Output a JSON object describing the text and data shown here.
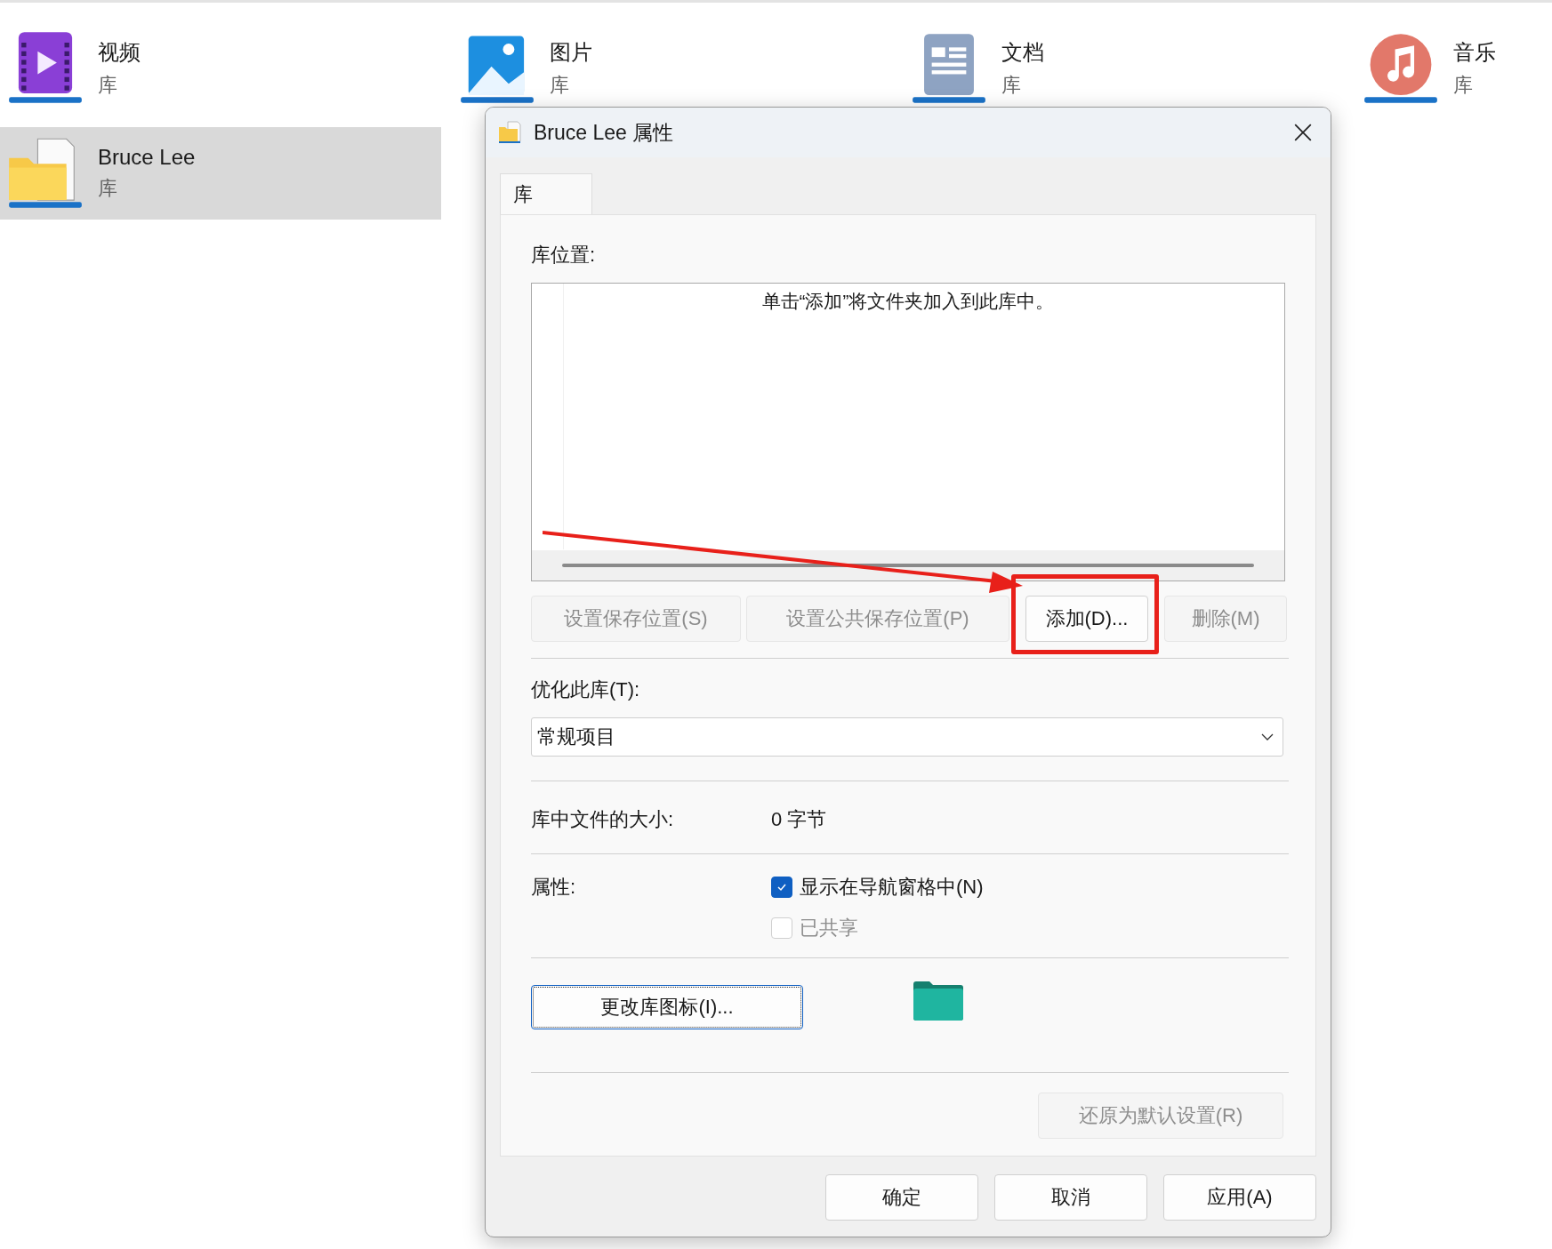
{
  "library_tiles": [
    {
      "name": "视频",
      "type": "库",
      "kind": "video",
      "selected": false
    },
    {
      "name": "图片",
      "type": "库",
      "kind": "picture",
      "selected": false
    },
    {
      "name": "文档",
      "type": "库",
      "kind": "document",
      "selected": false
    },
    {
      "name": "音乐",
      "type": "库",
      "kind": "music",
      "selected": false
    },
    {
      "name": "Bruce Lee",
      "type": "库",
      "kind": "folder",
      "selected": true
    }
  ],
  "dialog": {
    "title": "Bruce Lee 属性",
    "tabs": [
      {
        "label": "库",
        "selected": true
      }
    ],
    "location_label": "库位置:",
    "list_hint": "单击“添加”将文件夹加入到此库中。",
    "location_buttons": [
      {
        "label": "设置保存位置(S)",
        "disabled": true,
        "highlighted": false
      },
      {
        "label": "设置公共保存位置(P)",
        "disabled": true,
        "highlighted": false
      },
      {
        "label": "添加(D)...",
        "disabled": false,
        "highlighted": true
      },
      {
        "label": "删除(M)",
        "disabled": true,
        "highlighted": false
      }
    ],
    "optimize_label": "优化此库(T):",
    "optimize_value": "常规项目",
    "size_label": "库中文件的大小:",
    "size_value": "0 字节",
    "attributes_label": "属性:",
    "checkboxes": [
      {
        "label": "显示在导航窗格中(N)",
        "checked": true,
        "disabled": false
      },
      {
        "label": "已共享",
        "checked": false,
        "disabled": true
      }
    ],
    "change_icon_button": "更改库图标(I)...",
    "restore_button": {
      "label": "还原为默认设置(R)",
      "disabled": true
    },
    "footer_buttons": [
      "确定",
      "取消",
      "应用(A)"
    ]
  }
}
